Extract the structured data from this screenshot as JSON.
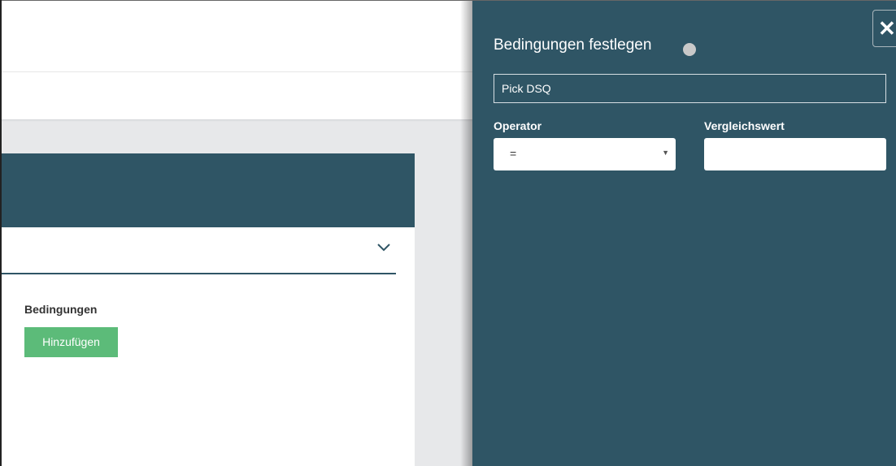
{
  "background_page": {
    "conditions_label": "Bedingungen",
    "add_button_label": "Hinzufügen"
  },
  "panel": {
    "title": "Bedingungen festlegen",
    "close_symbol": "✕",
    "name_value": "Pick DSQ",
    "operator_label": "Operator",
    "operator_value": "=",
    "operator_arrow": "▼",
    "compare_label": "Vergleichswert",
    "compare_value": ""
  },
  "colors": {
    "panel_bg": "#2f5565",
    "add_button": "#5cbb79",
    "status_dot": "#c9c9c9"
  },
  "icons": {
    "close": "close-icon",
    "dropdown": "chevron-down-icon",
    "status": "status-dot-icon"
  }
}
